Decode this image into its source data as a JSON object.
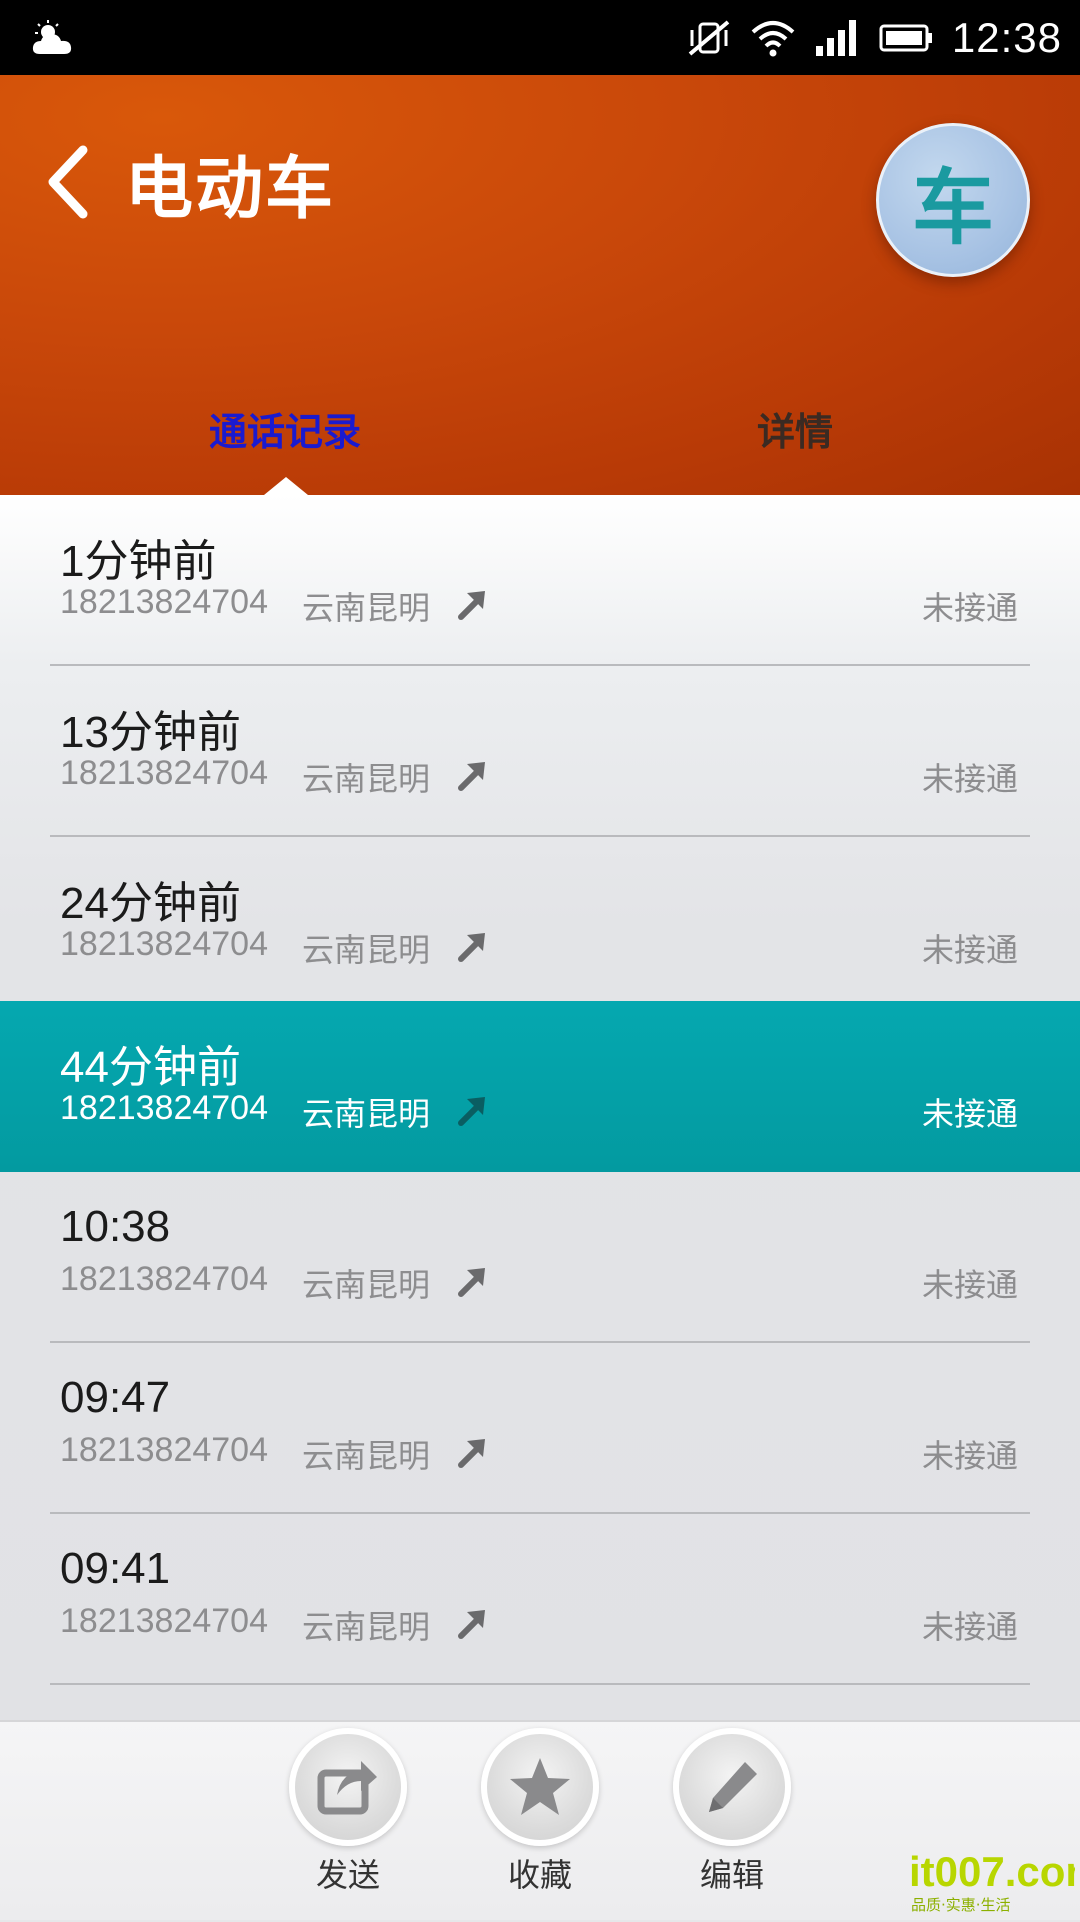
{
  "status_bar": {
    "time": "12:38",
    "icons": [
      "weather-cloud-icon",
      "silent-vibrate-off-icon",
      "wifi-icon",
      "signal-icon",
      "battery-icon"
    ]
  },
  "header": {
    "title": "电动车",
    "avatar_letter": "车",
    "back_icon": "chevron-left-icon",
    "tabs": [
      {
        "label": "通话记录",
        "active": true
      },
      {
        "label": "详情",
        "active": false
      }
    ],
    "colors": {
      "background": "#c9480a",
      "active_tab": "#1a1acf",
      "inactive_tab": "#3a2a22"
    }
  },
  "calls": [
    {
      "time": "1分钟前",
      "number": "18213824704",
      "location": "云南昆明",
      "direction_icon": "outgoing-call-arrow-icon",
      "status": "未接通",
      "selected": false
    },
    {
      "time": "13分钟前",
      "number": "18213824704",
      "location": "云南昆明",
      "direction_icon": "outgoing-call-arrow-icon",
      "status": "未接通",
      "selected": false
    },
    {
      "time": "24分钟前",
      "number": "18213824704",
      "location": "云南昆明",
      "direction_icon": "outgoing-call-arrow-icon",
      "status": "未接通",
      "selected": false
    },
    {
      "time": "44分钟前",
      "number": "18213824704",
      "location": "云南昆明",
      "direction_icon": "outgoing-call-arrow-icon",
      "status": "未接通",
      "selected": true
    },
    {
      "time": "10:38",
      "number": "18213824704",
      "location": "云南昆明",
      "direction_icon": "outgoing-call-arrow-icon",
      "status": "未接通",
      "selected": false
    },
    {
      "time": "09:47",
      "number": "18213824704",
      "location": "云南昆明",
      "direction_icon": "outgoing-call-arrow-icon",
      "status": "未接通",
      "selected": false
    },
    {
      "time": "09:41",
      "number": "18213824704",
      "location": "云南昆明",
      "direction_icon": "outgoing-call-arrow-icon",
      "status": "未接通",
      "selected": false
    }
  ],
  "selected_row_color": "#04a2a8",
  "actions": {
    "send": {
      "label": "发送",
      "icon": "share-icon"
    },
    "favorite": {
      "label": "收藏",
      "icon": "star-icon"
    },
    "edit": {
      "label": "编辑",
      "icon": "pencil-icon"
    }
  },
  "watermark": {
    "text": "it007.com",
    "subtext": "品质·实惠·生活"
  }
}
